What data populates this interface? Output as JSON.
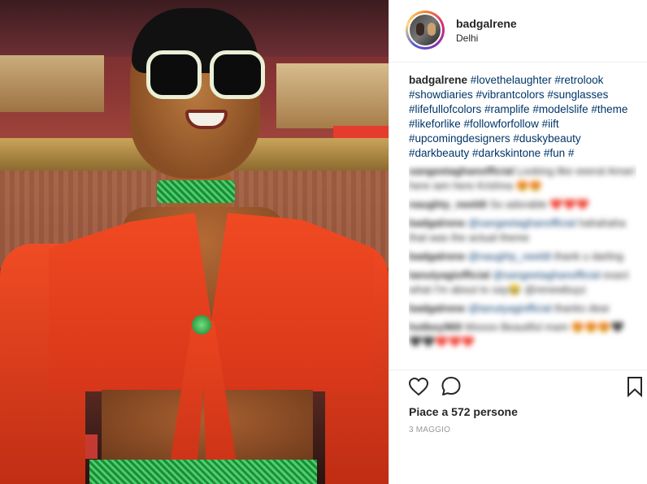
{
  "post": {
    "username": "badgalrene",
    "location": "Delhi",
    "caption_user": "badgalrene",
    "caption_tags": "#lovethelaughter #retrolook #showdiaries #vibrantcolors #sunglasses #lifefullofcolors #ramplife #modelslife #theme #likeforlike #followforfollow #iift #upcomingdesigners #duskybeauty #darkbeauty #darkskintone #fun #"
  },
  "comments": [
    {
      "user": "sangeetaghanofficial",
      "mention": "",
      "text": "Looking like eeeral Amari here iam here Krishna 😍😍"
    },
    {
      "user": "naughty_neeldt",
      "mention": "",
      "text": "So adorable ❤️❤️❤️"
    },
    {
      "user": "badgalrene",
      "mention": "@sangeetaghanofficial",
      "text": "hahahaha that was the actual theme"
    },
    {
      "user": "badgalrene",
      "mention": "@naughty_neeldt",
      "text": "thank u darling"
    },
    {
      "user": "tanutyagiofficial",
      "mention": "@sangeetaghanofficial",
      "text": "exact what I'm about to say😂 @renewbuyz"
    },
    {
      "user": "badgalrene",
      "mention": "@tanutyagiofficial",
      "text": "thanks dear"
    },
    {
      "user": "hotboy969",
      "mention": "",
      "text": "Woooo Beautiful mam 😍😍😍🖤🖤🖤❤️❤️❤️"
    }
  ],
  "engagement": {
    "likes_text": "Piace a 572 persone",
    "date_text": "3 MAGGIO"
  },
  "icons": {
    "like": "heart-icon",
    "comment": "speech-bubble-icon",
    "save": "bookmark-icon"
  },
  "colors": {
    "text": "#262626",
    "hashtag": "#003569",
    "muted": "#999999"
  }
}
